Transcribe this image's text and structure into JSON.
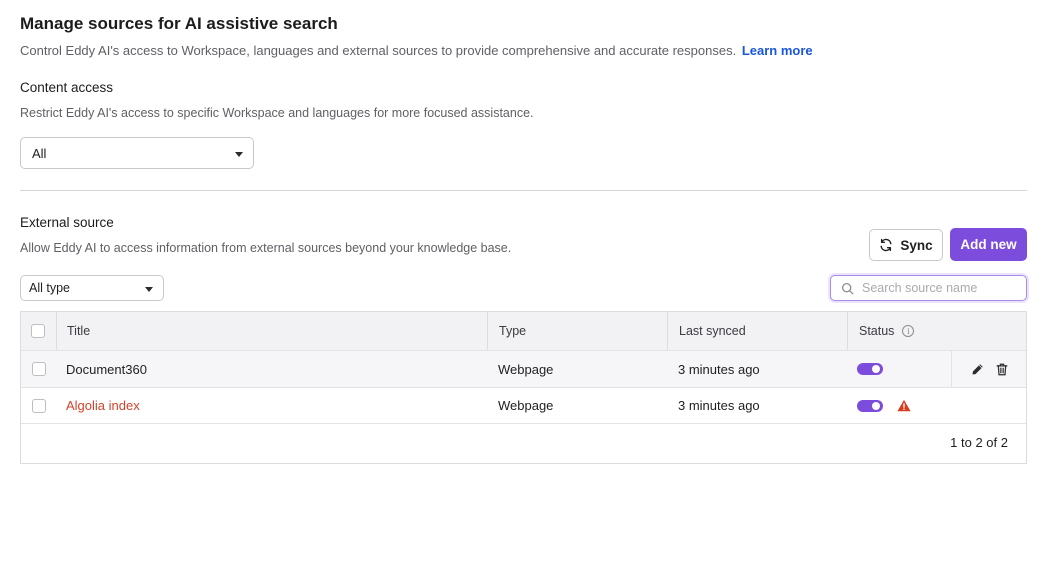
{
  "header": {
    "title": "Manage sources for AI assistive search",
    "subtitle": "Control Eddy AI's access to Workspace, languages and external sources to provide comprehensive and accurate responses.",
    "learn_more": "Learn more"
  },
  "content_access": {
    "title": "Content access",
    "description": "Restrict Eddy AI's access to specific Workspace and languages for more focused assistance.",
    "selected": "All"
  },
  "external_source": {
    "title": "External source",
    "description": "Allow Eddy AI to access information from external sources beyond your knowledge base.",
    "sync_label": "Sync",
    "add_label": "Add new",
    "type_filter": "All type",
    "search_placeholder": "Search source name",
    "accent_color": "#7c4ddd"
  },
  "table": {
    "columns": [
      "Title",
      "Type",
      "Last synced",
      "Status"
    ],
    "rows": [
      {
        "title": "Document360",
        "type": "Webpage",
        "last_synced": "3 minutes ago",
        "enabled": true,
        "warning": false
      },
      {
        "title": "Algolia index",
        "type": "Webpage",
        "last_synced": "3 minutes ago",
        "enabled": true,
        "warning": true
      }
    ],
    "pagination": "1 to 2 of 2"
  }
}
